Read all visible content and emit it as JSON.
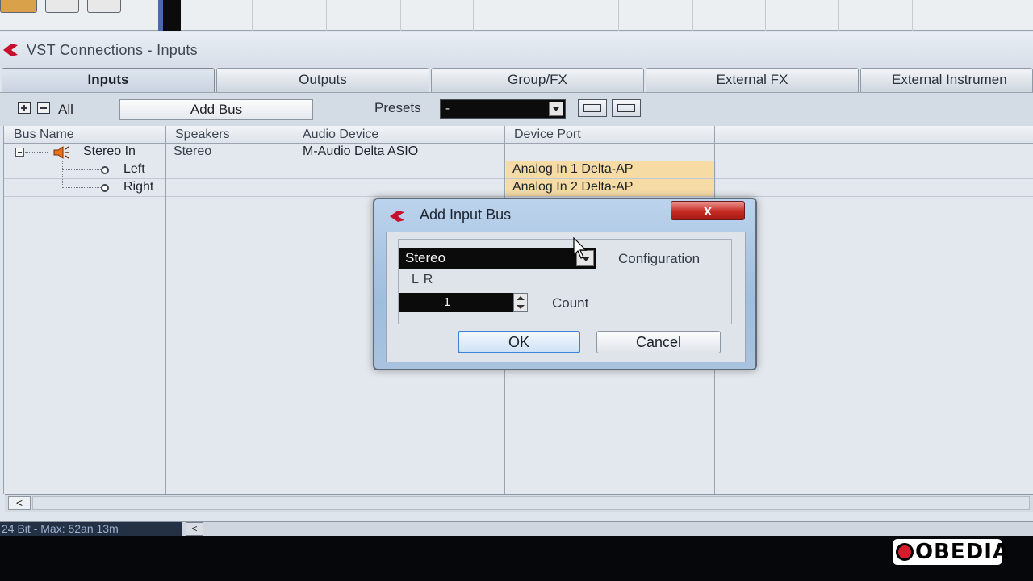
{
  "window": {
    "title": "VST Connections - Inputs"
  },
  "tabs": [
    {
      "label": "Inputs",
      "active": true
    },
    {
      "label": "Outputs",
      "active": false
    },
    {
      "label": "Group/FX",
      "active": false
    },
    {
      "label": "External FX",
      "active": false
    },
    {
      "label": "External Instrumen",
      "active": false
    }
  ],
  "toolbar": {
    "all_label": "All",
    "add_bus_label": "Add Bus",
    "presets_label": "Presets",
    "presets_value": "-"
  },
  "table": {
    "columns": [
      "Bus Name",
      "Speakers",
      "Audio Device",
      "Device Port"
    ],
    "rows": [
      {
        "bus_name": "Stereo In",
        "speakers": "Stereo",
        "audio_device": "M-Audio Delta ASIO",
        "device_port": ""
      },
      {
        "bus_name": "Left",
        "speakers": "",
        "audio_device": "",
        "device_port": "Analog In 1 Delta-AP"
      },
      {
        "bus_name": "Right",
        "speakers": "",
        "audio_device": "",
        "device_port": "Analog In 2 Delta-AP"
      }
    ]
  },
  "status": {
    "text": "24 Bit - Max: 52an 13m",
    "arrow": "<"
  },
  "dialog": {
    "title": "Add Input Bus",
    "close_label": "x",
    "configuration_value": "Stereo",
    "configuration_label": "Configuration",
    "channels_label": "L R",
    "count_value": "1",
    "count_label": "Count",
    "ok_label": "OK",
    "cancel_label": "Cancel"
  },
  "scrollbar": {
    "left_arrow": "<"
  },
  "brand": {
    "name": "OBEDIA"
  },
  "colors": {
    "accent": "#3d82d8",
    "port_highlight": "#f6dca4",
    "close_red": "#c52a22",
    "logo_red": "#c8102e"
  }
}
